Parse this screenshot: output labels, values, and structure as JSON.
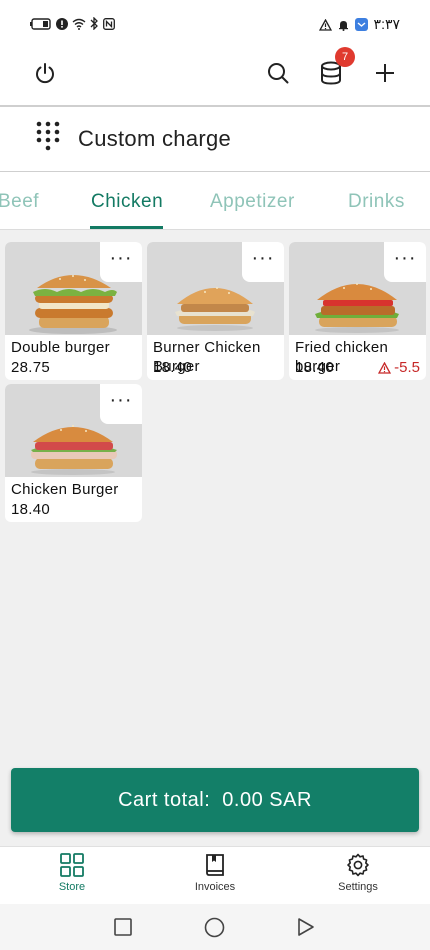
{
  "status_bar": {
    "time": "٣:٣٧",
    "left_icons": [
      "battery-icon",
      "sim-alert-icon",
      "wifi-icon",
      "bluetooth-icon",
      "nfc-icon"
    ],
    "right_icons": [
      "warning-icon",
      "notification-bell-icon",
      "app-notification-icon"
    ]
  },
  "header": {
    "badge_count": "7",
    "icons": [
      "power-icon",
      "search-icon",
      "database-icon",
      "plus-icon"
    ]
  },
  "custom_charge": {
    "label": "Custom charge"
  },
  "tabs": [
    {
      "label": "Beef",
      "active": false
    },
    {
      "label": "Chicken",
      "active": true
    },
    {
      "label": "Appetizer",
      "active": false
    },
    {
      "label": "Drinks",
      "active": false
    }
  ],
  "products": [
    {
      "name": "Double burger",
      "price": "28.75",
      "warning": ""
    },
    {
      "name": "Burner Chicken Burger",
      "price": "18.40",
      "warning": ""
    },
    {
      "name": "Fried chicken burger",
      "price": "18.40",
      "warning": "-5.5"
    },
    {
      "name": "Chicken Burger",
      "price": "18.40",
      "warning": ""
    }
  ],
  "more_label": "···",
  "cart": {
    "label": "Cart total:",
    "amount": "0.00 SAR"
  },
  "bottom_nav": [
    {
      "label": "Store",
      "icon": "grid-icon",
      "active": true
    },
    {
      "label": "Invoices",
      "icon": "book-icon",
      "active": false
    },
    {
      "label": "Settings",
      "icon": "gear-icon",
      "active": false
    }
  ],
  "colors": {
    "accent": "#137f68",
    "tab_inactive": "#8fc4b8",
    "badge": "#e03a2f",
    "warning": "#c62828"
  }
}
